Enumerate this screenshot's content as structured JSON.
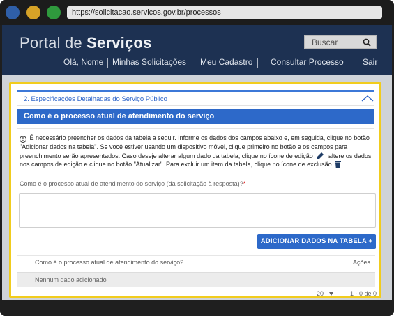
{
  "browser": {
    "url": "https://solicitacao.servicos.gov.br/processos",
    "colors": {
      "close": "#2f5fa8",
      "minimize": "#d7a327",
      "maximize": "#2f9a3d"
    }
  },
  "header": {
    "brand_light": "Portal de",
    "brand_bold": "Serviços",
    "search_placeholder": "Buscar",
    "nav": [
      "Olá, Nome",
      "Minhas Solicitações",
      "Meu Cadastro",
      "Consultar Processo",
      "Sair"
    ]
  },
  "section": {
    "title": "2. Especificações Detalhadas do Serviço Público",
    "bar_title": "Como é o processo atual de atendimento do serviço",
    "info_part1": "É necessário preencher os dados da tabela a seguir. Informe os dados dos campos abaixo e, em seguida, clique no botão \"Adicionar dados na tabela\". Se você estiver usando um dispositivo móvel, clique primeiro no botão e os campos para preenchimento serão apresentados. Caso deseje alterar algum dado da tabela, clique no ícone de edição",
    "info_part2": "altere os dados nos campos de edição e clique no botão \"Atualizar\". Para excluir um item da tabela, clique no ícone de exclusão",
    "field_label": "Como é o processo atual de atendimento do serviço (da solicitação à resposta)?",
    "required_mark": "*",
    "field_value": "",
    "add_button": "ADICIONAR DADOS NA TABELA +"
  },
  "table": {
    "columns": [
      "Como é o processo atual de atendimento do serviço?",
      "Ações"
    ],
    "empty_message": "Nenhum dado adicionado",
    "page_size": "20",
    "range": "1 - 0 de 0"
  },
  "colors": {
    "header": "#1d3152",
    "accent": "#2d69c9",
    "highlight_border": "#f1cc1d"
  }
}
